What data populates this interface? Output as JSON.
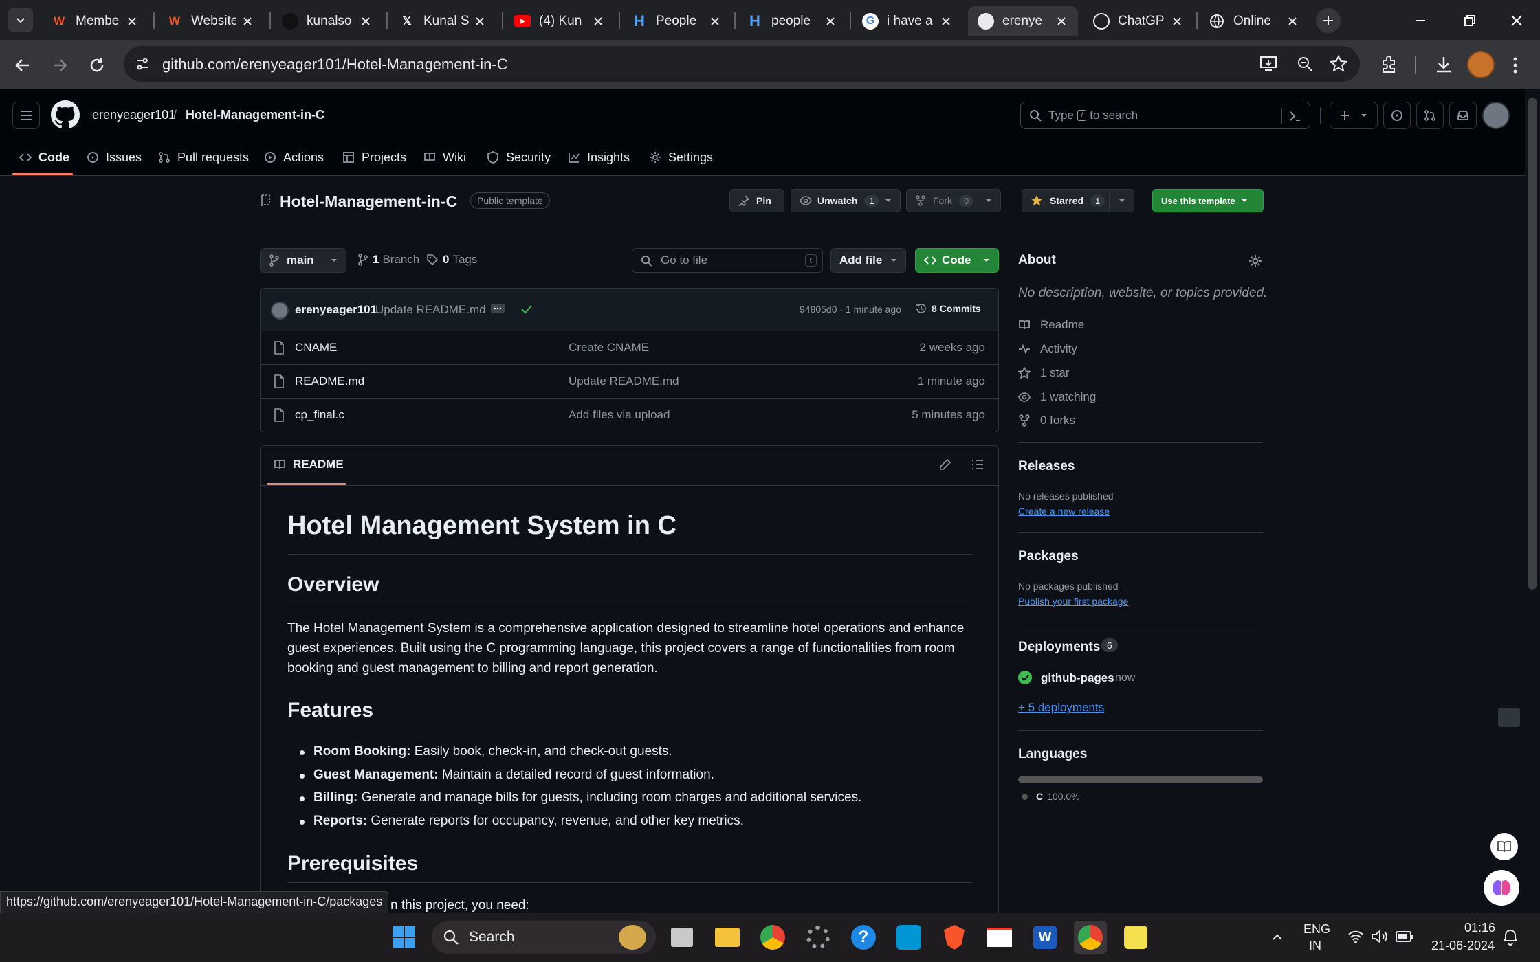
{
  "browser": {
    "tabs": [
      {
        "title": "Membe",
        "icon": "w-icon"
      },
      {
        "title": "Website",
        "icon": "w-icon"
      },
      {
        "title": "kunalso",
        "icon": "avatar-icon"
      },
      {
        "title": "Kunal S",
        "icon": "x-icon"
      },
      {
        "title": "(4) Kun",
        "icon": "youtube-icon"
      },
      {
        "title": "People",
        "icon": "h-icon"
      },
      {
        "title": "people",
        "icon": "h-icon"
      },
      {
        "title": "i have a",
        "icon": "google-icon"
      },
      {
        "title": "erenye",
        "icon": "github-icon"
      },
      {
        "title": "ChatGP",
        "icon": "chatgpt-icon"
      },
      {
        "title": "Online",
        "icon": "globe-icon"
      }
    ],
    "url": "github.com/erenyeager101/Hotel-Management-in-C",
    "status_url": "https://github.com/erenyeager101/Hotel-Management-in-C/packages"
  },
  "github": {
    "owner": "erenyeager101",
    "separator": "/",
    "repo": "Hotel-Management-in-C",
    "search_placeholder_pre": "Type",
    "search_key": "/",
    "search_placeholder_post": "to search",
    "nav": [
      "Code",
      "Issues",
      "Pull requests",
      "Actions",
      "Projects",
      "Wiki",
      "Security",
      "Insights",
      "Settings"
    ]
  },
  "repo": {
    "name": "Hotel-Management-in-C",
    "visibility": "Public template",
    "pin_label": "Pin",
    "unwatch_label": "Unwatch",
    "unwatch_count": "1",
    "fork_label": "Fork",
    "fork_count": "0",
    "starred_label": "Starred",
    "star_count": "1",
    "use_template_label": "Use this template",
    "branch": "main",
    "branch_count": "1",
    "branch_label": "Branch",
    "tag_count": "0",
    "tag_label": "Tags",
    "go_to_file": "Go to file",
    "go_to_file_key": "t",
    "add_file": "Add file",
    "code_label": "Code",
    "commit": {
      "author": "erenyeager101",
      "message": "Update README.md",
      "hash_time": "94805d0 · 1 minute ago",
      "commits_count": "8",
      "commits_label": "Commits"
    },
    "files": [
      {
        "name": "CNAME",
        "message": "Create CNAME",
        "time": "2 weeks ago"
      },
      {
        "name": "README.md",
        "message": "Update README.md",
        "time": "1 minute ago"
      },
      {
        "name": "cp_final.c",
        "message": "Add files via upload",
        "time": "5 minutes ago"
      }
    ]
  },
  "readme": {
    "tab_label": "README",
    "h1": "Hotel Management System in C",
    "overview_h": "Overview",
    "overview_p": "The Hotel Management System is a comprehensive application designed to streamline hotel operations and enhance guest experiences. Built using the C programming language, this project covers a range of functionalities from room booking and guest management to billing and report generation.",
    "features_h": "Features",
    "features": [
      {
        "bold": "Room Booking:",
        "text": " Easily book, check-in, and check-out guests."
      },
      {
        "bold": "Guest Management:",
        "text": " Maintain a detailed record of guest information."
      },
      {
        "bold": "Billing:",
        "text": " Generate and manage bills for guests, including room charges and additional services."
      },
      {
        "bold": "Reports:",
        "text": " Generate reports for occupancy, revenue, and other key metrics."
      }
    ],
    "prereq_h": "Prerequisites",
    "prereq_p_partial": "n this project, you need:"
  },
  "sidebar": {
    "about_h": "About",
    "about_desc": "No description, website, or topics provided.",
    "items": [
      {
        "label": "Readme",
        "icon": "book-icon"
      },
      {
        "label": "Activity",
        "icon": "pulse-icon"
      },
      {
        "label": "1 star",
        "icon": "star-icon"
      },
      {
        "label": "1 watching",
        "icon": "eye-icon"
      },
      {
        "label": "0 forks",
        "icon": "fork-icon"
      }
    ],
    "releases_h": "Releases",
    "releases_none": "No releases published",
    "releases_link": "Create a new release",
    "packages_h": "Packages",
    "packages_none": "No packages published",
    "packages_link": "Publish your first package",
    "deployments_h": "Deployments",
    "deployments_count": "6",
    "deploy_name": "github-pages",
    "deploy_time": "now",
    "deploy_more": "+ 5 deployments",
    "languages_h": "Languages",
    "language": "C",
    "language_pct": "100.0%",
    "language_fraction": 1.0
  },
  "taskbar": {
    "search": "Search",
    "lang_top": "ENG",
    "lang_bottom": "IN",
    "time": "01:16",
    "date": "21-06-2024"
  },
  "colors": {
    "accent_green": "#238636",
    "link_blue": "#4493f8",
    "star_yellow": "#e3b341",
    "nav_underline": "#f78166"
  }
}
